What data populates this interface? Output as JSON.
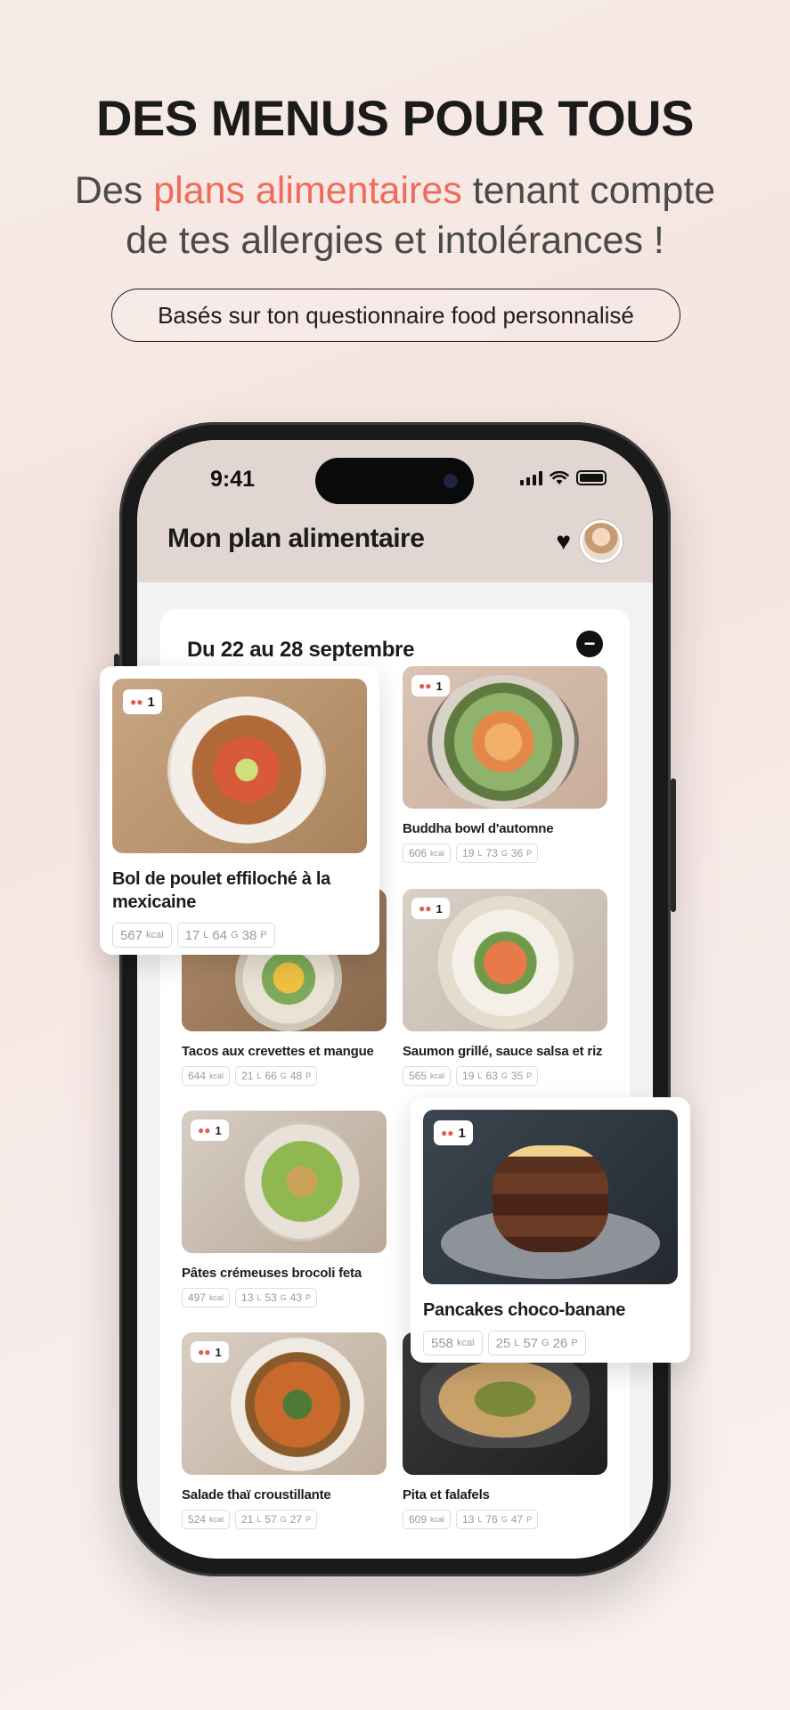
{
  "hero": {
    "headline": "DES MENUS POUR TOUS",
    "sub_before": "Des ",
    "sub_accent": "plans alimentaires",
    "sub_after": " tenant compte",
    "sub_line2": "de tes allergies et intolérances !",
    "pill": "Basés sur ton questionnaire food personnalisé",
    "accent_color": "#ef6b5a"
  },
  "status_bar": {
    "time": "9:41"
  },
  "app": {
    "title": "Mon plan alimentaire",
    "heart_icon": "heart-icon",
    "week_title": "Du 22 au 28 septembre",
    "collapse_icon": "minus-icon"
  },
  "recipes": [
    {
      "name": "Bol de poulet effiloché à la mexicaine",
      "servings": "1",
      "kcal": "567",
      "kcal_unit": "kcal",
      "l": "17",
      "g": "64",
      "p": "38"
    },
    {
      "name": "Buddha bowl d'automne",
      "servings": "1",
      "kcal": "606",
      "kcal_unit": "kcal",
      "l": "19",
      "g": "73",
      "p": "36"
    },
    {
      "name": "Tacos aux crevettes et mangue",
      "servings": "1",
      "kcal": "644",
      "kcal_unit": "kcal",
      "l": "21",
      "g": "66",
      "p": "48"
    },
    {
      "name": "Saumon grillé, sauce salsa et riz",
      "servings": "1",
      "kcal": "565",
      "kcal_unit": "kcal",
      "l": "19",
      "g": "63",
      "p": "35"
    },
    {
      "name": "Pâtes crémeuses brocoli feta",
      "servings": "1",
      "kcal": "497",
      "kcal_unit": "kcal",
      "l": "13",
      "g": "53",
      "p": "43"
    },
    {
      "name": "Pancakes choco-banane",
      "servings": "1",
      "kcal": "558",
      "kcal_unit": "kcal",
      "l": "25",
      "g": "57",
      "p": "26"
    },
    {
      "name": "Salade thaï croustillante",
      "servings": "1",
      "kcal": "524",
      "kcal_unit": "kcal",
      "l": "21",
      "g": "57",
      "p": "27"
    },
    {
      "name": "Pita et falafels",
      "servings": "1",
      "kcal": "609",
      "kcal_unit": "kcal",
      "l": "13",
      "g": "76",
      "p": "47"
    }
  ],
  "macro_units": {
    "l": "L",
    "g": "G",
    "p": "P"
  }
}
